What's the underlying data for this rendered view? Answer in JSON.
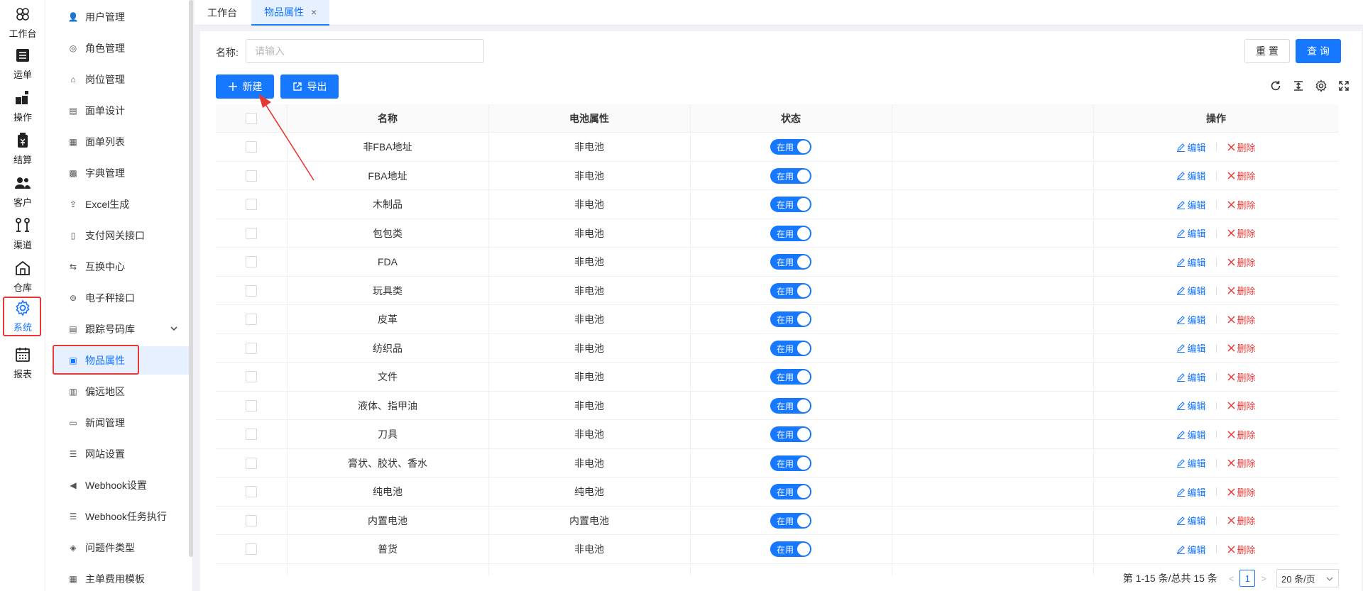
{
  "rail": [
    {
      "label": "工作台",
      "icon": "clover-icon"
    },
    {
      "label": "运单",
      "icon": "list-icon"
    },
    {
      "label": "操作",
      "icon": "tool-icon"
    },
    {
      "label": "结算",
      "icon": "money-icon"
    },
    {
      "label": "客户",
      "icon": "users-icon"
    },
    {
      "label": "渠道",
      "icon": "route-icon"
    },
    {
      "label": "仓库",
      "icon": "warehouse-icon"
    },
    {
      "label": "系统",
      "icon": "gear-icon",
      "active": true
    },
    {
      "label": "报表",
      "icon": "calendar-icon"
    }
  ],
  "submenu": [
    {
      "label": "用户管理",
      "icon": "user-icon"
    },
    {
      "label": "角色管理",
      "icon": "role-icon"
    },
    {
      "label": "岗位管理",
      "icon": "post-icon"
    },
    {
      "label": "面单设计",
      "icon": "design-icon"
    },
    {
      "label": "面单列表",
      "icon": "grid-icon"
    },
    {
      "label": "字典管理",
      "icon": "dict-icon"
    },
    {
      "label": "Excel生成",
      "icon": "upload-icon"
    },
    {
      "label": "支付网关接口",
      "icon": "phone-icon"
    },
    {
      "label": "互换中心",
      "icon": "exchange-icon"
    },
    {
      "label": "电子秤接口",
      "icon": "scale-icon"
    },
    {
      "label": "跟踪号码库",
      "icon": "db-icon",
      "expandable": true
    },
    {
      "label": "物品属性",
      "icon": "item-icon",
      "active": true
    },
    {
      "label": "偏远地区",
      "icon": "area-icon"
    },
    {
      "label": "新闻管理",
      "icon": "news-icon"
    },
    {
      "label": "网站设置",
      "icon": "site-icon"
    },
    {
      "label": "Webhook设置",
      "icon": "megaphone-icon"
    },
    {
      "label": "Webhook任务执行",
      "icon": "task-icon"
    },
    {
      "label": "问题件类型",
      "icon": "shield-icon"
    },
    {
      "label": "主单费用模板",
      "icon": "template-icon"
    }
  ],
  "tabs": [
    {
      "label": "工作台"
    },
    {
      "label": "物品属性",
      "active": true,
      "close": "×"
    }
  ],
  "search": {
    "label": "名称:",
    "placeholder": "请输入",
    "value": ""
  },
  "buttons": {
    "reset": "重 置",
    "query": "查 询",
    "new": "新建",
    "export": "导出"
  },
  "table": {
    "columns": [
      "名称",
      "电池属性",
      "状态",
      "",
      "操作"
    ],
    "rows": [
      {
        "name": "非FBA地址",
        "battery": "非电池",
        "status": "在用"
      },
      {
        "name": "FBA地址",
        "battery": "非电池",
        "status": "在用"
      },
      {
        "name": "木制品",
        "battery": "非电池",
        "status": "在用"
      },
      {
        "name": "包包类",
        "battery": "非电池",
        "status": "在用"
      },
      {
        "name": "FDA",
        "battery": "非电池",
        "status": "在用"
      },
      {
        "name": "玩具类",
        "battery": "非电池",
        "status": "在用"
      },
      {
        "name": "皮革",
        "battery": "非电池",
        "status": "在用"
      },
      {
        "name": "纺织品",
        "battery": "非电池",
        "status": "在用"
      },
      {
        "name": "文件",
        "battery": "非电池",
        "status": "在用"
      },
      {
        "name": "液体、指甲油",
        "battery": "非电池",
        "status": "在用"
      },
      {
        "name": "刀具",
        "battery": "非电池",
        "status": "在用"
      },
      {
        "name": "膏状、胶状、香水",
        "battery": "非电池",
        "status": "在用"
      },
      {
        "name": "纯电池",
        "battery": "纯电池",
        "status": "在用"
      },
      {
        "name": "内置电池",
        "battery": "内置电池",
        "status": "在用"
      },
      {
        "name": "普货",
        "battery": "非电池",
        "status": "在用"
      }
    ],
    "actions": {
      "edit": "编辑",
      "delete": "删除"
    }
  },
  "pagination": {
    "summary": "第 1-15 条/总共 15 条",
    "current": "1",
    "page_size": "20 条/页"
  },
  "colors": {
    "primary": "#1677ff",
    "danger": "#e53935"
  }
}
